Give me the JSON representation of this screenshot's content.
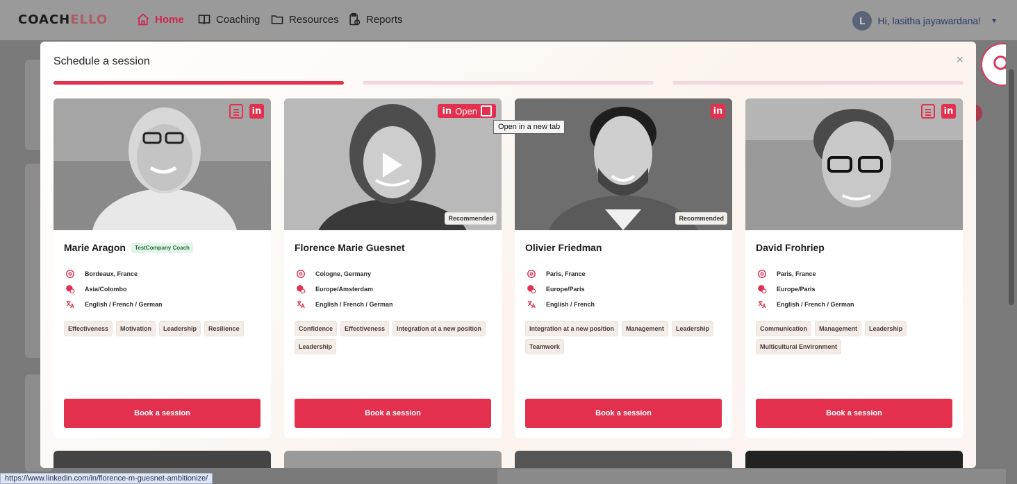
{
  "app": {
    "logo_dark": "COACH",
    "logo_light": "ELLO"
  },
  "nav": {
    "items": [
      {
        "label": "Home",
        "icon": "home-icon",
        "active": true
      },
      {
        "label": "Coaching",
        "icon": "book-icon",
        "active": false
      },
      {
        "label": "Resources",
        "icon": "folder-icon",
        "active": false
      },
      {
        "label": "Reports",
        "icon": "clipboard-icon",
        "active": false
      }
    ],
    "user": {
      "initial": "L",
      "greeting": "Hi, lasitha jayawardana!"
    }
  },
  "modal": {
    "title": "Schedule a session",
    "close": "×",
    "steps": [
      {
        "active": true
      },
      {
        "active": false
      },
      {
        "active": false
      }
    ]
  },
  "coaches": [
    {
      "name": "Marie Aragon",
      "company_tag": "TestCompany Coach",
      "location": "Bordeaux, France",
      "timezone": "Asia/Colombo",
      "languages": "English / French / German",
      "tags": [
        "Effectiveness",
        "Motivation",
        "Leadership",
        "Resilience"
      ],
      "recommended": "",
      "book_label": "Book a session"
    },
    {
      "name": "Florence Marie Guesnet",
      "company_tag": "",
      "location": "Cologne, Germany",
      "timezone": "Europe/Amsterdam",
      "languages": "English / French / German",
      "tags": [
        "Confidence",
        "Effectiveness",
        "Integration at a new position",
        "Leadership"
      ],
      "recommended": "Recommended",
      "open_label": "Open",
      "book_label": "Book a session"
    },
    {
      "name": "Olivier Friedman",
      "company_tag": "",
      "location": "Paris, France",
      "timezone": "Europe/Paris",
      "languages": "English / French",
      "tags": [
        "Integration at a new position",
        "Management",
        "Leadership",
        "Teamwork"
      ],
      "recommended": "Recommended",
      "book_label": "Book a session"
    },
    {
      "name": "David Frohriep",
      "company_tag": "",
      "location": "Paris, France",
      "timezone": "Europe/Paris",
      "languages": "English / French / German",
      "tags": [
        "Communication",
        "Management",
        "Leadership",
        "Multicultural Environment"
      ],
      "recommended": "",
      "book_label": "Book a session"
    }
  ],
  "tooltip": "Open in a new tab",
  "status_url": "https://www.linkedin.com/in/florence-m-guesnet-ambitionize/",
  "colors": {
    "accent": "#e3304f",
    "tag_bg": "#f4ece6",
    "company_tag_bg": "#e3f4e8"
  }
}
